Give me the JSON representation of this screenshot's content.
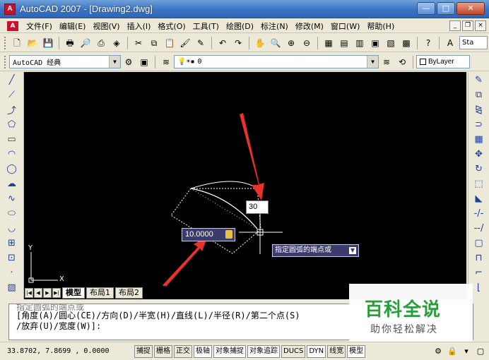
{
  "window": {
    "title": "AutoCAD 2007 - [Drawing2.dwg]",
    "minimize": "—",
    "maximize": "□",
    "close": "✕"
  },
  "menus": [
    "文件(F)",
    "编辑(E)",
    "视图(V)",
    "插入(I)",
    "格式(O)",
    "工具(T)",
    "绘图(D)",
    "标注(N)",
    "修改(M)",
    "窗口(W)",
    "帮助(H)"
  ],
  "mdi_buttons": [
    "_",
    "❐",
    "×"
  ],
  "toolbar": {
    "workspace": "AutoCAD 经典",
    "layer": "0",
    "color": "ByLayer",
    "text_style": "Sta"
  },
  "canvas": {
    "angle_input": "30",
    "radius_input": "10.0000",
    "tooltip": "指定圆弧的端点或",
    "ucs_y": "Y",
    "ucs_x": "X"
  },
  "layout_tabs": [
    "模型",
    "布局1",
    "布局2"
  ],
  "command_lines": {
    "previous": "指定圆弧的端点或",
    "options_line1": "[角度(A)/圆心(CE)/方向(D)/半宽(H)/直线(L)/半径(R)/第二个点(S)",
    "options_line2": "/放弃(U)/宽度(W)]:"
  },
  "watermark": {
    "title": "百科全说",
    "subtitle": "助你轻松解决"
  },
  "status": {
    "coordinates": "33.8702, 7.8699 , 0.0000",
    "toggles": [
      "捕捉",
      "栅格",
      "正交",
      "极轴",
      "对象捕捉",
      "对象追踪",
      "DUCS",
      "DYN",
      "线宽",
      "模型"
    ]
  },
  "colors": {
    "title_bar": "#3a74c4",
    "canvas_bg": "#000000",
    "arrow": "#e8322a",
    "dyn_box": "#3c3c6c",
    "watermark_green": "#2b9e3c"
  }
}
